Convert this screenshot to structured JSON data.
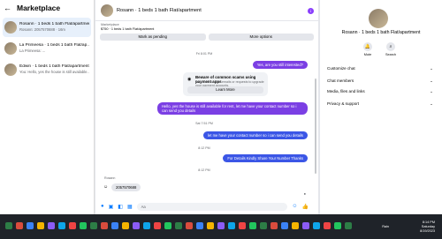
{
  "left": {
    "title": "Marketplace",
    "conversations": [
      {
        "name": "Rosann · 1 beds 1 bath Flat/apartment",
        "preview": "Rosann: 2057570688 · 16m"
      },
      {
        "name": "La Primeesa · 1 beds 1 bath Flat/ap...",
        "preview": "La Primeesa: ..."
      },
      {
        "name": "Edwin · 1 beds 1 bath Flat/apartment",
        "preview": "You: Hello, yes the house is still available..."
      }
    ]
  },
  "center": {
    "chat_title": "Rosann · 1 beds 1 bath Flat/apartment",
    "listing_label": "Marketplace",
    "listing_text": "$750 · 1 beds 1 bath Flat/apartment",
    "mark_pending": "Mark as pending",
    "more_options": "More options",
    "messages": {
      "ts1": "Fri 8:01 PM",
      "out1": "Yes, are you still interested?",
      "card_title": "Beware of common scams using payment apps",
      "card_sub": "Watch out for fake emails or requests to upgrade your payment accounts.",
      "card_button": "Learn More",
      "out2": "Hello, yes the house is still available for rent, let me have your contact number so i can send you details",
      "ts2": "Sat 7:51 PM",
      "out3": "let me have your contact number so i can send you details",
      "ts3": "8:12 PM",
      "out4": "For  Details Kindly Share Your Number Thanks",
      "ts4": "8:12 PM",
      "sender": "Rosann",
      "in1": "2057570688"
    },
    "composer_placeholder": "Aa"
  },
  "right": {
    "name": "Rosann · 1 beds 1 bath Flat/apartment",
    "mute_label": "Mute",
    "search_label": "Search",
    "menu": [
      "Customize chat",
      "Chat members",
      "Media, files and links",
      "Privacy & support"
    ]
  },
  "taskbar": {
    "weather": "Rain",
    "time": "8:14 PM",
    "day": "Saturday",
    "date": "8/19/2023"
  }
}
